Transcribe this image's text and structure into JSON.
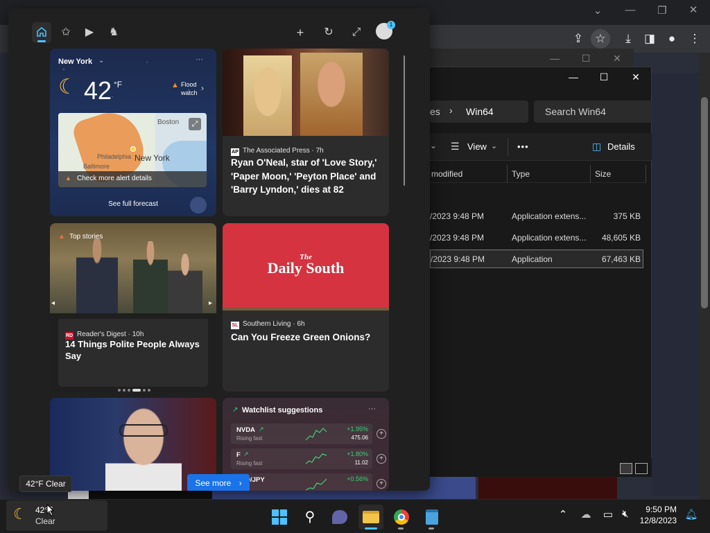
{
  "browser": {
    "window_controls": [
      "⌄",
      "—",
      "❐",
      "✕"
    ],
    "toolbar_icons": [
      "share-icon",
      "star-icon",
      "download-icon",
      "sidebar-icon",
      "profile-icon",
      "menu-icon"
    ]
  },
  "explorer": {
    "breadcrumb_partial": "es",
    "breadcrumb_current": "Win64",
    "search_placeholder": "Search Win64",
    "view_label": "View",
    "more_label": "•••",
    "details_label": "Details",
    "columns": [
      "modified",
      "Type",
      "Size"
    ],
    "rows": [
      {
        "modified": "/2023 9:48 PM",
        "type": "Application extens...",
        "size": "375 KB"
      },
      {
        "modified": "/2023 9:48 PM",
        "type": "Application extens...",
        "size": "48,605 KB"
      },
      {
        "modified": "/2023 9:48 PM",
        "type": "Application",
        "size": "67,463 KB"
      }
    ]
  },
  "widgets": {
    "weather": {
      "location": "New York",
      "temperature": "42",
      "unit": "°F",
      "alert": "Flood watch",
      "map_labels": {
        "boston": "Boston",
        "philadelphia": "Philadelphia",
        "baltimore": "Baltimore",
        "new_york": "New York"
      },
      "alert_details": "Check more alert details",
      "forecast_button": "See full forecast"
    },
    "news_ap": {
      "source_logo": "AP",
      "source": "The Associated Press · 7h",
      "headline": "Ryan O'Neal, star of 'Love Story,' 'Paper Moon,' 'Peyton Place' and 'Barry Lyndon,' dies at 82"
    },
    "top_stories": {
      "label": "Top stories",
      "source_logo": "RD",
      "source": "Reader's Digest · 10h",
      "headline": "14 Things Polite People Always Say"
    },
    "daily_south": {
      "logo_top": "The",
      "logo_main": "Daily South",
      "source_logo": "SL",
      "source": "Southern Living · 6h",
      "headline": "Can You Freeze Green Onions?"
    },
    "watchlist": {
      "title": "Watchlist suggestions",
      "stocks": [
        {
          "symbol": "NVDA",
          "sub": "Rising fast",
          "change": "+1.95%",
          "price": "475.06"
        },
        {
          "symbol": "F",
          "sub": "Rising fast",
          "change": "+1.80%",
          "price": "11.02"
        },
        {
          "symbol": "USD/JPY",
          "sub": "",
          "change": "+0.56%",
          "price": ""
        }
      ]
    },
    "see_more": "See more",
    "more_dots": "···"
  },
  "tooltip": "42°F Clear",
  "taskbar": {
    "weather_temp": "42°F",
    "weather_condition": "Clear",
    "time": "9:50 PM",
    "date": "12/8/2023"
  }
}
